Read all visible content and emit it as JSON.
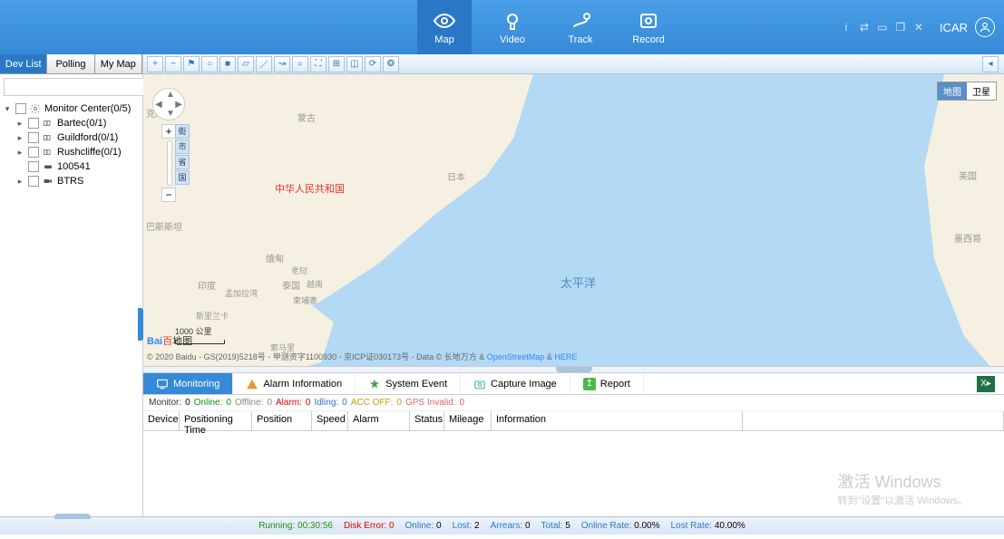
{
  "header": {
    "nav": [
      {
        "label": "Map"
      },
      {
        "label": "Video"
      },
      {
        "label": "Track"
      },
      {
        "label": "Record"
      }
    ],
    "user": "ICAR"
  },
  "sidebar": {
    "tabs": [
      "Dev List",
      "Polling",
      "My Map"
    ],
    "tree": {
      "root": "Monitor Center(0/5)",
      "children": [
        "Bartec(0/1)",
        "Guildford(0/1)",
        "Rushcliffe(0/1)",
        "100541",
        "BTRS"
      ]
    }
  },
  "map": {
    "type_buttons": [
      "地图",
      "卫星"
    ],
    "zoom_labels": [
      "街",
      "市",
      "省",
      "国"
    ],
    "labels": {
      "mongolia": "蒙古",
      "kst": "克斯坦",
      "pak": "巴斯斯坦",
      "china": "中华人民共和国",
      "japan": "日本",
      "india": "印度",
      "bengal": "孟加拉湾",
      "myanmar": "缅甸",
      "laos": "老挝",
      "thailand": "泰国",
      "cambodia": "柬埔寨",
      "vietnam": "越南",
      "srilanka": "斯里兰卡",
      "usa": "美国",
      "mexico": "墨西哥",
      "pacific": "太平洋",
      "somalia": "索马里"
    },
    "scale": "1000 公里",
    "baidu": {
      "b1": "Bai",
      "b2": "百",
      "b3": "地图"
    },
    "copyright": "© 2020 Baidu - GS(2019)5218号 - 甲测资字1100930 - 京ICP证030173号 - Data © 长地万方 & ",
    "osm": "OpenStreetMap",
    "amp": " & ",
    "here": "HERE"
  },
  "bottom": {
    "tabs": [
      "Monitoring",
      "Alarm Information",
      "System Event",
      "Capture Image",
      "Report"
    ],
    "monitor": {
      "monitor_l": "Monitor:",
      "monitor_v": "0",
      "online_l": "Online:",
      "online_v": "0",
      "offline_l": "Offline:",
      "offline_v": "0",
      "alarm_l": "Alarm:",
      "alarm_v": "0",
      "idling_l": "Idling:",
      "idling_v": "0",
      "accoff_l": "ACC OFF:",
      "accoff_v": "0",
      "gps_l": "GPS Invalid:",
      "gps_v": "0"
    },
    "columns": [
      "Device",
      "Positioning Time",
      "Position",
      "Speed",
      "Alarm",
      "Status",
      "Mileage",
      "Information"
    ]
  },
  "footer": {
    "running_l": "Running:",
    "running_v": "00:30:56",
    "disk_l": "Disk Error:",
    "disk_v": "0",
    "online_l": "Online:",
    "online_v": "0",
    "lost_l": "Lost:",
    "lost_v": "2",
    "arrears_l": "Arrears:",
    "arrears_v": "0",
    "total_l": "Total:",
    "total_v": "5",
    "orate_l": "Online Rate:",
    "orate_v": "0.00%",
    "lrate_l": "Lost Rate:",
    "lrate_v": "40.00%"
  },
  "watermark": {
    "l1": "激活 Windows",
    "l2": "转到\"设置\"以激活 Windows。"
  }
}
